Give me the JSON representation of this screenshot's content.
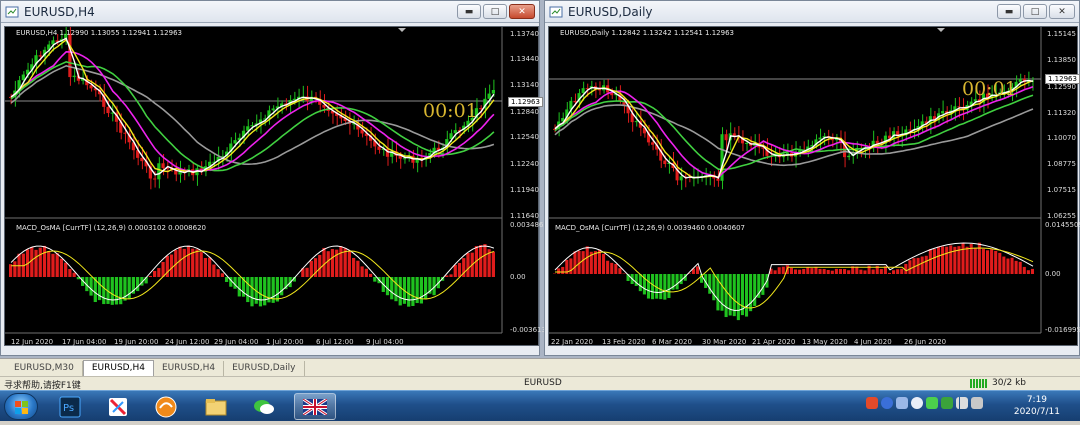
{
  "left_window": {
    "title": "EURUSD,H4",
    "symbol_line": "EURUSD,H4  1.12990 1.13055 1.12941 1.12963",
    "price_labels": [
      "1.13740",
      "1.13440",
      "1.13140",
      "1.12840",
      "1.12540",
      "1.12240",
      "1.11940",
      "1.11640"
    ],
    "current_price": "1.12963",
    "countdown": "00:01",
    "indicator_line": "MACD_OsMA [CurrTF] (12,26,9) 0.0003102 0.0008620",
    "indicator_labels": [
      "0.0034865",
      "0.00",
      "-0.003613"
    ],
    "time_labels": [
      "12 Jun 2020",
      "17 Jun 04:00",
      "19 Jun 20:00",
      "24 Jun 12:00",
      "29 Jun 04:00",
      "1 Jul 20:00",
      "6 Jul 12:00",
      "9 Jul 04:00"
    ]
  },
  "right_window": {
    "title": "EURUSD,Daily",
    "symbol_line": "EURUSD,Daily  1.12842 1.13242 1.12541 1.12963",
    "price_labels": [
      "1.15145",
      "1.13850",
      "1.12590",
      "1.11320",
      "1.10070",
      "1.08775",
      "1.07515",
      "1.06255"
    ],
    "current_price": "1.12963",
    "countdown": "00:01",
    "indicator_line": "MACD_OsMA [CurrTF] (12,26,9) 0.0039460 0.0040607",
    "indicator_labels": [
      "0.0145509",
      "0.00",
      "-0.016995"
    ],
    "time_labels": [
      "22 Jan 2020",
      "13 Feb 2020",
      "6 Mar 2020",
      "30 Mar 2020",
      "21 Apr 2020",
      "13 May 2020",
      "4 Jun 2020",
      "26 Jun 2020"
    ]
  },
  "tabs": [
    "EURUSD,M30",
    "EURUSD,H4",
    "EURUSD,H4",
    "EURUSD,Daily"
  ],
  "active_tab": 1,
  "status": {
    "help": "寻求帮助,请按F1键",
    "profile": "EURUSD",
    "traffic": "30/2 kb"
  },
  "taskbar": {
    "time": "7:19",
    "date": "2020/7/11",
    "apps": [
      "start-button",
      "photoshop",
      "paint",
      "app-orange",
      "file-explorer",
      "wechat",
      "uk-flag"
    ],
    "tray_icons": [
      "sogou-s",
      "help",
      "bluetooth",
      "cloud",
      "wechat",
      "shield",
      "network",
      "volume"
    ]
  },
  "colors": {
    "bull": "#1fc21f",
    "bear": "#e01c1c",
    "ma_white": "#ffffff",
    "ma_yellow": "#f2e81c",
    "ma_magenta": "#ee22ee",
    "ma_green": "#40d040",
    "ma_gray": "#9a9a9a",
    "countdown": "#d8b630"
  }
}
